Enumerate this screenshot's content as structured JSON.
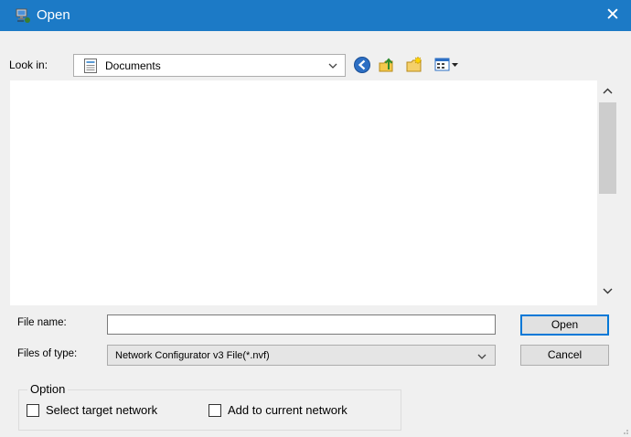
{
  "window": {
    "title": "Open",
    "close_glyph": "✕",
    "icon": "computer-network-icon",
    "titlebar_color": "#1c7ac6"
  },
  "look_in": {
    "label": "Look in:",
    "value": "Documents",
    "icon": "documents-folder-icon"
  },
  "toolbar": {
    "buttons": [
      "back-icon",
      "up-folder-icon",
      "new-folder-icon",
      "view-menu-icon"
    ]
  },
  "file_name": {
    "label": "File name:",
    "value": ""
  },
  "files_of_type": {
    "label": "Files of type:",
    "value": "Network Configurator v3 File(*.nvf)"
  },
  "buttons": {
    "open": "Open",
    "cancel": "Cancel"
  },
  "option": {
    "legend": "Option",
    "select_target_network": {
      "label": "Select target network",
      "checked": false
    },
    "add_to_current_network": {
      "label": "Add to current network",
      "checked": false
    }
  }
}
